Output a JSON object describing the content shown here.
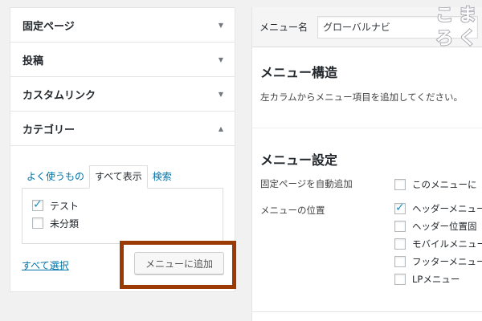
{
  "left_accordion": {
    "items": [
      {
        "label": "固定ページ",
        "arrow": "▼"
      },
      {
        "label": "投稿",
        "arrow": "▼"
      },
      {
        "label": "カスタムリンク",
        "arrow": "▼"
      },
      {
        "label": "カテゴリー",
        "arrow": "▲"
      }
    ],
    "tabs": [
      "よく使うもの",
      "すべて表示",
      "検索"
    ],
    "active_tab": "すべて表示",
    "categories": [
      {
        "label": "テスト",
        "checked": true
      },
      {
        "label": "未分類",
        "checked": false
      }
    ],
    "select_all": "すべて選択",
    "add_button": "メニューに追加"
  },
  "menu_header": {
    "name_label": "メニュー名",
    "name_value": "グローバルナビ"
  },
  "menu_structure": {
    "title": "メニュー構造",
    "description": "左カラムからメニュー項目を追加してください。"
  },
  "menu_settings": {
    "title": "メニュー設定",
    "auto_add_label": "固定ページを自動追加",
    "auto_add_option": "このメニューに",
    "location_label": "メニューの位置",
    "locations": [
      {
        "label": "ヘッダーメニュー",
        "checked": true
      },
      {
        "label": "ヘッダー位置固",
        "checked": false
      },
      {
        "label": "モバイルメニュー",
        "checked": false
      },
      {
        "label": "フッターメニュー",
        "checked": false
      },
      {
        "label": "LPメニュー",
        "checked": false
      }
    ]
  },
  "logo": {
    "chars": [
      "こ",
      "ま",
      "ろ",
      "く"
    ],
    "color": "#a9aab0"
  },
  "colors": {
    "highlight": "#9b3a05",
    "link": "#0073aa",
    "check": "#1e8cbe"
  }
}
